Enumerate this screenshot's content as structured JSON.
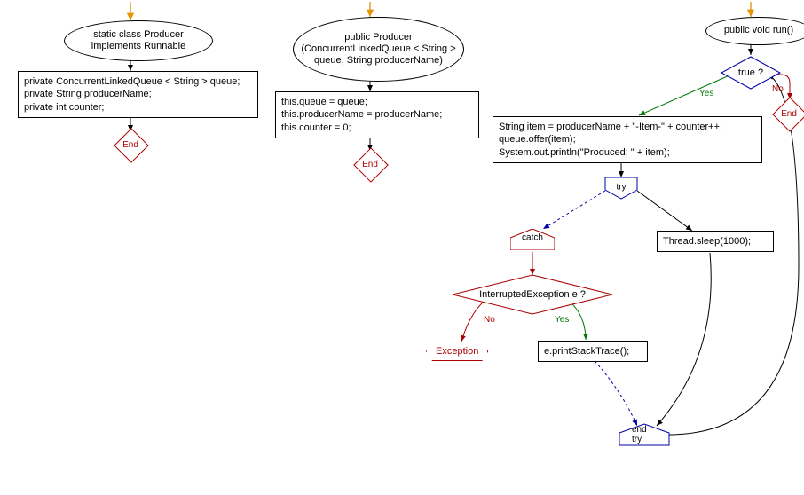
{
  "fc1": {
    "start": "static class Producer implements Runnable",
    "body": "private ConcurrentLinkedQueue < String > queue;\nprivate String producerName;\nprivate int counter;",
    "end": "End"
  },
  "fc2": {
    "start": "public Producer (ConcurrentLinkedQueue < String > queue, String producerName)",
    "body": "this.queue = queue;\nthis.producerName = producerName;\nthis.counter = 0;",
    "end": "End"
  },
  "fc3": {
    "start": "public void run()",
    "decision1": "true ?",
    "yes1": "Yes",
    "no1": "No",
    "end1": "End",
    "produce": "String item = producerName + \"-Item-\" + counter++;\nqueue.offer(item);\nSystem.out.println(\"Produced: \" + item);",
    "try": "try",
    "sleep": "Thread.sleep(1000);",
    "catch": "catch",
    "decision2": "InterruptedException e ?",
    "yes2": "Yes",
    "no2": "No",
    "exception": "Exception",
    "printStack": "e.printStackTrace();",
    "endtry": "end try"
  }
}
